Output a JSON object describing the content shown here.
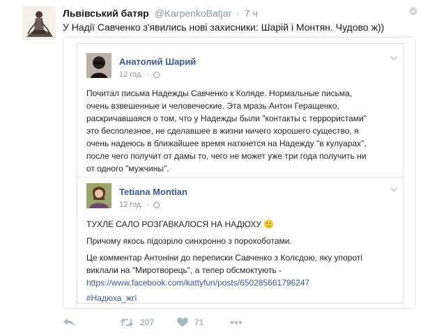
{
  "tweet": {
    "author_name": "Львівський батяр",
    "username": "@KarpenkoBatjar",
    "separator": "·",
    "time": "7 ч",
    "text": "У Надії Савченко з'явились нові захисники: Шарій і Монтян. Чудово ж))"
  },
  "quoted_screenshot": {
    "post1": {
      "author": "Анатолий Шарий",
      "time": "12 год.",
      "body_lines": [
        "Почитал письма Надежды Савченко к Коляде. Нормальные письма,",
        "очень взвешенные и человеческие. Эта мразь Антон Геращенко,",
        "раскричавшаяся о том, что у Надежды были \"контакты с террористами\"",
        "это бесполезное, не сделавшее в жизни ничего хорошего существо, я",
        "очень надеюсь в ближайшее время наткнется на Надежду \"в кулуарах\",",
        "после чего получит от дамы то, чего не может уже три года получить ни",
        "от одного \"мужчины\"."
      ]
    },
    "post2": {
      "author": "Tetiana Montian",
      "time": "12 год.",
      "line1": "ТУХЛЕ САЛО РОЗГАВКАЛОСЯ НА НАДЮХУ 🙂",
      "line2": "Причому якось підозріло синхронно з порохоботами.",
      "line3a": "Це комментар Антоніни до переписки Савченко з Колєдою, яку упороті",
      "line3b": "виклали на \"Миротворець\", а тепер обсмоктують -",
      "link": "https://www.facebook.com/kattyfun/posts/650285661796247",
      "hashtag": "#Надюха_жгі"
    }
  },
  "actions": {
    "retweets": "207",
    "likes": "71"
  },
  "colors": {
    "fb_name": "#3b5998",
    "muted": "#8899a6",
    "action_icon": "#aab8c2"
  }
}
